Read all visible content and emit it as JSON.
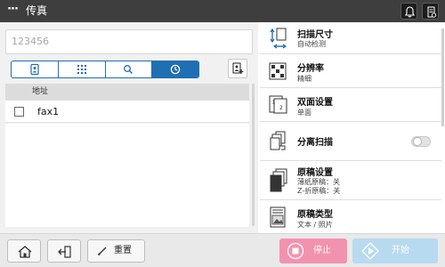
{
  "header": {
    "menu_icon": "ellipsis-icon",
    "title": "传真",
    "right_icons": [
      "bell-icon",
      "device-status-icon"
    ]
  },
  "destination": {
    "input_value": "123456"
  },
  "tabs": [
    {
      "icon": "address-book-icon",
      "active": false
    },
    {
      "icon": "keypad-icon",
      "active": false
    },
    {
      "icon": "search-icon",
      "active": false
    },
    {
      "icon": "history-clock-icon",
      "active": true
    }
  ],
  "destination_list": {
    "column_header": "地址",
    "rows": [
      {
        "label": "fax1",
        "checked": false
      }
    ]
  },
  "settings": [
    {
      "icon": "scan-size-icon",
      "title": "扫描尺寸",
      "value": "自动检测"
    },
    {
      "icon": "resolution-icon",
      "title": "分辨率",
      "value": "精细"
    },
    {
      "icon": "duplex-icon",
      "title": "双面设置",
      "value": "单面"
    },
    {
      "icon": "separate-scan-icon",
      "title": "分离扫描",
      "toggle": false
    },
    {
      "icon": "original-settings-icon",
      "title": "原稿设置",
      "value_lines": [
        "薄纸原稿：关",
        "Z-折原稿：关"
      ]
    },
    {
      "icon": "original-type-icon",
      "title": "原稿类型",
      "value": "文本 / 照片"
    }
  ],
  "bottom": {
    "home_icon": "home-icon",
    "exit_icon": "exit-icon",
    "reset_label": "重置",
    "stop_label": "停止",
    "start_label": "开始"
  },
  "colors": {
    "topbar": "#3e3e3e",
    "accent": "#1f6fb4",
    "stop": "#f392ae",
    "start": "#b8daf1"
  }
}
